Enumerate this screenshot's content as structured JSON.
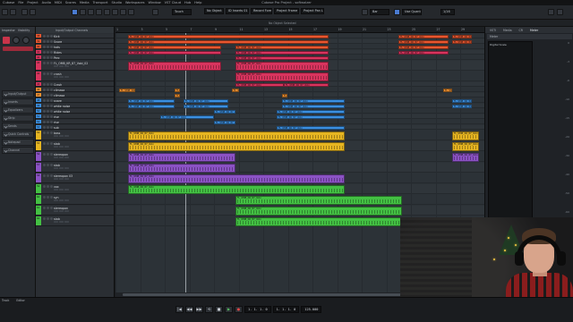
{
  "window": {
    "title": "Cubase Pro Project - softwalzer"
  },
  "menu": [
    "Cubase",
    "File",
    "Project",
    "Audio",
    "MIDI",
    "Scores",
    "Media",
    "Transport",
    "Studio",
    "Workspaces",
    "Window",
    "VST Cloud",
    "Hub",
    "Help"
  ],
  "toolbar": {
    "mode": "Touch",
    "info_fields": [
      "No Object Selected",
      "ID Inserts 01",
      "Record Formats",
      "Project Frame Rate",
      "Project Pan Law",
      "Tempo 125.000",
      "Signature",
      "Control Room"
    ],
    "grid": "Bar",
    "quantize": "1/16",
    "use_quantize": "Use Quantize"
  },
  "inspector": {
    "tabs": [
      "Inspector",
      "Visibility"
    ],
    "sections": [
      "Input/Output",
      "Inserts",
      "Equalizers",
      "Strip",
      "Sends",
      "Quick Controls",
      "Notepad",
      "Channel"
    ]
  },
  "tracklist": {
    "header": "Input/Output Channels",
    "tracks": [
      {
        "num": "38",
        "name": "Kick",
        "color": "#e8562f"
      },
      {
        "num": "39",
        "name": "Snare",
        "color": "#e8562f"
      },
      {
        "num": "40",
        "name": "hats",
        "color": "#e8562f"
      },
      {
        "num": "41",
        "name": "Rides",
        "color": "#d8345e"
      },
      {
        "num": "42",
        "name": "Perc",
        "color": "#d8345e"
      },
      {
        "num": "43",
        "name": "FL_OMB_KR_87_Vobi_02",
        "color": "#d8345e"
      },
      {
        "num": "44",
        "name": "crash",
        "color": "#d8345e"
      },
      {
        "num": "45",
        "name": "Crash",
        "color": "#d8345e"
      },
      {
        "num": "46",
        "name": "cllmasa",
        "color": "#f0902f"
      },
      {
        "num": "47",
        "name": "cllmasa",
        "color": "#f0902f"
      },
      {
        "num": "48",
        "name": "snare",
        "color": "#3b8fe0"
      },
      {
        "num": "49",
        "name": "white noise",
        "color": "#3b8fe0"
      },
      {
        "num": "50",
        "name": "white noise",
        "color": "#3b8fe0"
      },
      {
        "num": "51",
        "name": "rise",
        "color": "#3b8fe0"
      },
      {
        "num": "52",
        "name": "rise",
        "color": "#3b8fe0"
      },
      {
        "num": "53",
        "name": "sub",
        "color": "#3b8fe0"
      },
      {
        "num": "54",
        "name": "bass",
        "color": "#e6b521"
      },
      {
        "num": "55",
        "name": "stab",
        "color": "#e6b521"
      },
      {
        "num": "56",
        "name": "stereopan",
        "color": "#8b52c4"
      },
      {
        "num": "57",
        "name": "stab",
        "color": "#8b52c4"
      },
      {
        "num": "58",
        "name": "stereopan 03",
        "color": "#8b52c4"
      },
      {
        "num": "59",
        "name": "vox",
        "color": "#43c043"
      },
      {
        "num": "60",
        "name": "syn",
        "color": "#43c043"
      },
      {
        "num": "61",
        "name": "stereopan",
        "color": "#43c043"
      },
      {
        "num": "62",
        "name": "stab",
        "color": "#43c043"
      }
    ]
  },
  "arrange": {
    "ruler": [
      "1",
      "3",
      "5",
      "7",
      "9",
      "11",
      "13",
      "15",
      "17",
      "19",
      "21",
      "23",
      "25",
      "27",
      "29"
    ],
    "selection_info": "No Object Selected",
    "clip_label": "FL_OMB_KR_87_Vobi"
  },
  "rightzone": {
    "tabs": [
      "VSTi",
      "Media",
      "CR",
      "Meter"
    ],
    "active_tab": "Meter",
    "panel_title": "Meter",
    "meter_label": "Digital Scale",
    "scale": [
      "0",
      "-3",
      "-6",
      "-10",
      "-15",
      "-20",
      "-30",
      "-40",
      "-50",
      "-60"
    ]
  },
  "bottom": {
    "tabs": [
      "Track",
      "Editor"
    ],
    "position": "1. 1. 1. 0",
    "end": "1. 1. 1. 0",
    "tempo": "125.000"
  }
}
